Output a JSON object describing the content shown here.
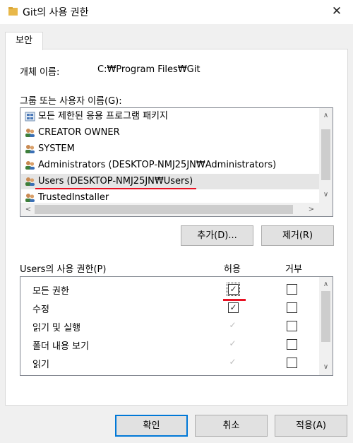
{
  "window": {
    "title": "Git의 사용 권한",
    "close_glyph": "✕"
  },
  "tabs": [
    {
      "label": "보안"
    }
  ],
  "object": {
    "label": "개체 이름:",
    "value": "C:₩Program Files₩Git"
  },
  "groups": {
    "label": "그룹 또는 사용자 이름(G):",
    "items": [
      {
        "name": "모든 제한된 응용 프로그램 패키지",
        "icon": "package-icon"
      },
      {
        "name": "CREATOR OWNER",
        "icon": "users-icon"
      },
      {
        "name": "SYSTEM",
        "icon": "users-icon"
      },
      {
        "name": "Administrators (DESKTOP-NMJ25JN₩Administrators)",
        "icon": "users-icon"
      },
      {
        "name": "Users (DESKTOP-NMJ25JN₩Users)",
        "icon": "users-icon",
        "selected": true
      },
      {
        "name": "TrustedInstaller",
        "icon": "users-icon"
      }
    ],
    "add_label": "추가(D)...",
    "remove_label": "제거(R)"
  },
  "permissions": {
    "label": "Users의 사용 권한(P)",
    "allow_header": "허용",
    "deny_header": "거부",
    "rows": [
      {
        "name": "모든 권한",
        "allow": true,
        "allow_disabled": false,
        "deny": false
      },
      {
        "name": "수정",
        "allow": true,
        "allow_disabled": false,
        "deny": false
      },
      {
        "name": "읽기 및 실행",
        "allow": true,
        "allow_disabled": true,
        "deny": false
      },
      {
        "name": "폴더 내용 보기",
        "allow": true,
        "allow_disabled": true,
        "deny": false
      },
      {
        "name": "읽기",
        "allow": true,
        "allow_disabled": true,
        "deny": false
      }
    ]
  },
  "footer": {
    "ok_label": "확인",
    "cancel_label": "취소",
    "apply_label": "적용(A)"
  },
  "colors": {
    "annotation_red": "#e81123",
    "default_button_border": "#0078d7",
    "selected_row": "#e5e5e5"
  }
}
